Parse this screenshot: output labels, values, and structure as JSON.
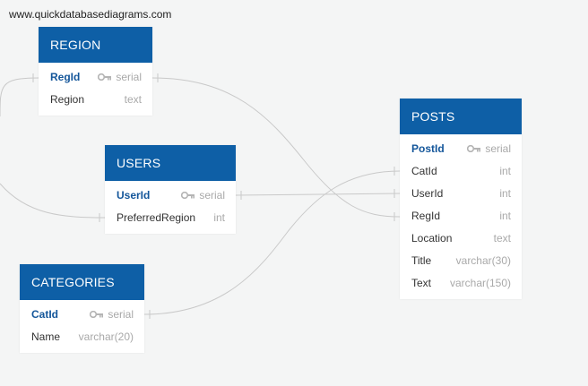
{
  "watermark": "www.quickdatabasediagrams.com",
  "colors": {
    "header": "#0e5fa6",
    "pk_text": "#14569a",
    "type_text": "#a9a9a9",
    "link": "#c9c9c9",
    "background": "#f4f5f5"
  },
  "tables": {
    "region": {
      "name": "REGION",
      "fields": [
        {
          "name": "RegId",
          "type": "serial",
          "pk": true,
          "icon": "key-icon"
        },
        {
          "name": "Region",
          "type": "text"
        }
      ]
    },
    "users": {
      "name": "USERS",
      "fields": [
        {
          "name": "UserId",
          "type": "serial",
          "pk": true,
          "icon": "key-icon"
        },
        {
          "name": "PreferredRegion",
          "type": "int"
        }
      ]
    },
    "categories": {
      "name": "CATEGORIES",
      "fields": [
        {
          "name": "CatId",
          "type": "serial",
          "pk": true,
          "icon": "key-icon"
        },
        {
          "name": "Name",
          "type": "varchar(20)"
        }
      ]
    },
    "posts": {
      "name": "POSTS",
      "fields": [
        {
          "name": "PostId",
          "type": "serial",
          "pk": true,
          "icon": "key-icon"
        },
        {
          "name": "CatId",
          "type": "int"
        },
        {
          "name": "UserId",
          "type": "int"
        },
        {
          "name": "RegId",
          "type": "int"
        },
        {
          "name": "Location",
          "type": "text"
        },
        {
          "name": "Title",
          "type": "varchar(30)"
        },
        {
          "name": "Text",
          "type": "varchar(150)"
        }
      ]
    }
  }
}
